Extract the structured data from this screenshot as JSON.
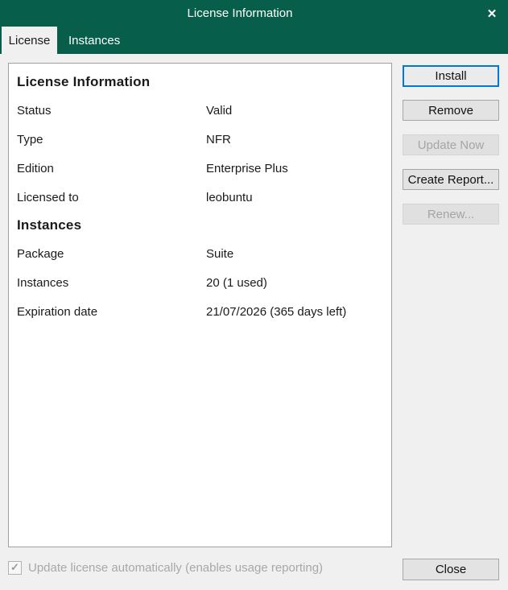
{
  "window": {
    "title": "License Information",
    "close_glyph": "✕"
  },
  "tabs": [
    {
      "label": "License",
      "active": true
    },
    {
      "label": "Instances",
      "active": false
    }
  ],
  "panel": {
    "sections": [
      {
        "header": "License Information",
        "rows": [
          {
            "label": "Status",
            "value": "Valid"
          },
          {
            "label": "Type",
            "value": "NFR"
          },
          {
            "label": "Edition",
            "value": "Enterprise Plus"
          },
          {
            "label": "Licensed to",
            "value": "leobuntu"
          }
        ]
      },
      {
        "header": "Instances",
        "rows": [
          {
            "label": "Package",
            "value": "Suite"
          },
          {
            "label": "Instances",
            "value": "20 (1 used)"
          },
          {
            "label": "Expiration date",
            "value": "21/07/2026 (365 days left)"
          }
        ]
      }
    ]
  },
  "buttons": [
    {
      "label": "Install",
      "state": "default-focused"
    },
    {
      "label": "Remove",
      "state": "enabled"
    },
    {
      "label": "Update Now",
      "state": "disabled"
    },
    {
      "label": "Create Report...",
      "state": "enabled"
    },
    {
      "label": "Renew...",
      "state": "disabled"
    }
  ],
  "footer": {
    "checkbox_label": "Update license automatically (enables usage reporting)",
    "checkbox_checked": true,
    "checkbox_enabled": false,
    "checkbox_glyph": "✓",
    "close_label": "Close"
  },
  "colors": {
    "titlebar_green": "#075f4b",
    "focus_blue": "#0078d7",
    "body_background": "#f0f0f0"
  }
}
